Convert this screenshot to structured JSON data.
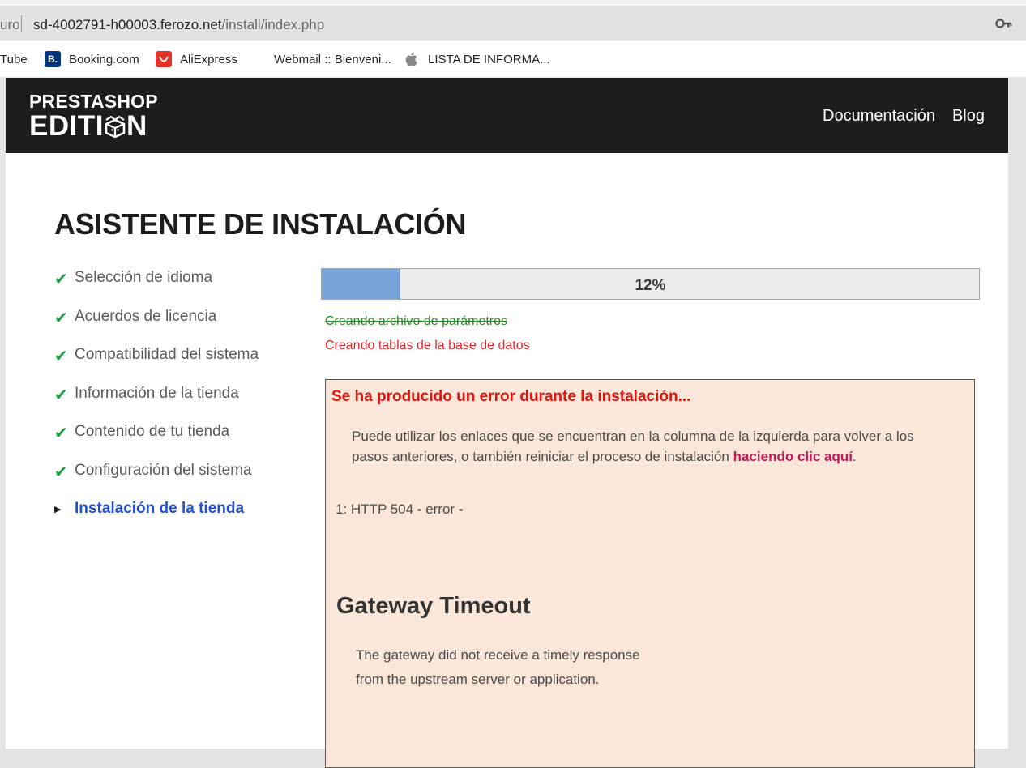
{
  "browser": {
    "url_prefix": "uro",
    "url_host": "sd-4002791-h00003.ferozo.net",
    "url_path": "/install/index.php",
    "key_icon": "key-icon",
    "bookmarks": [
      {
        "label": "Tube",
        "icon": "youtube-icon"
      },
      {
        "label": "Booking.com",
        "icon": "booking-icon",
        "icon_text": "B.",
        "color": "#003580"
      },
      {
        "label": "AliExpress",
        "icon": "aliexpress-icon",
        "color": "#e43225"
      },
      {
        "label": "Webmail :: Bienveni...",
        "icon": "none"
      },
      {
        "label": "LISTA DE INFORMA...",
        "icon": "apple-icon"
      }
    ]
  },
  "header": {
    "logo_top": "PRESTASHOP",
    "logo_bottom_left": "EDITI",
    "logo_bottom_right": "N",
    "nav": [
      "Documentación",
      "Blog"
    ],
    "background": "#1d1d1b"
  },
  "main": {
    "title": "ASISTENTE DE INSTALACIÓN",
    "steps": [
      {
        "label": "Selección de idioma",
        "status": "done"
      },
      {
        "label": "Acuerdos de licencia",
        "status": "done"
      },
      {
        "label": "Compatibilidad del sistema",
        "status": "done"
      },
      {
        "label": "Información de la tienda",
        "status": "done"
      },
      {
        "label": "Contenido de tu tienda",
        "status": "done"
      },
      {
        "label": "Configuración del sistema",
        "status": "done"
      },
      {
        "label": "Instalación de la tienda",
        "status": "current"
      }
    ],
    "progress": {
      "percent": 12,
      "label": "12%"
    },
    "tasks": {
      "done": "Creando archivo de parámetros",
      "current": "Creando tablas de la base de datos"
    },
    "error": {
      "title": "Se ha producido un error durante la instalación...",
      "desc_before": "Puede utilizar los enlaces que se encuentran en la columna de la izquierda para volver a los pasos anteriores, o también reiniciar el proceso de instalación ",
      "desc_link": "haciendo clic aquí",
      "desc_after": ".",
      "http_prefix": "1: HTTP 504 ",
      "http_sep1": "-",
      "http_mid": " error ",
      "http_sep2": "-",
      "gateway_title": "Gateway Timeout",
      "gateway_line1": "The gateway did not receive a timely response",
      "gateway_line2": "from the upstream server or application."
    },
    "colors": {
      "check": "#1f9b3c",
      "current_step": "#1f4fd6",
      "progress_fill": "#77a3d8",
      "error_red": "#e3140f",
      "error_bg": "#fae7d9",
      "link": "#c8195a"
    }
  }
}
